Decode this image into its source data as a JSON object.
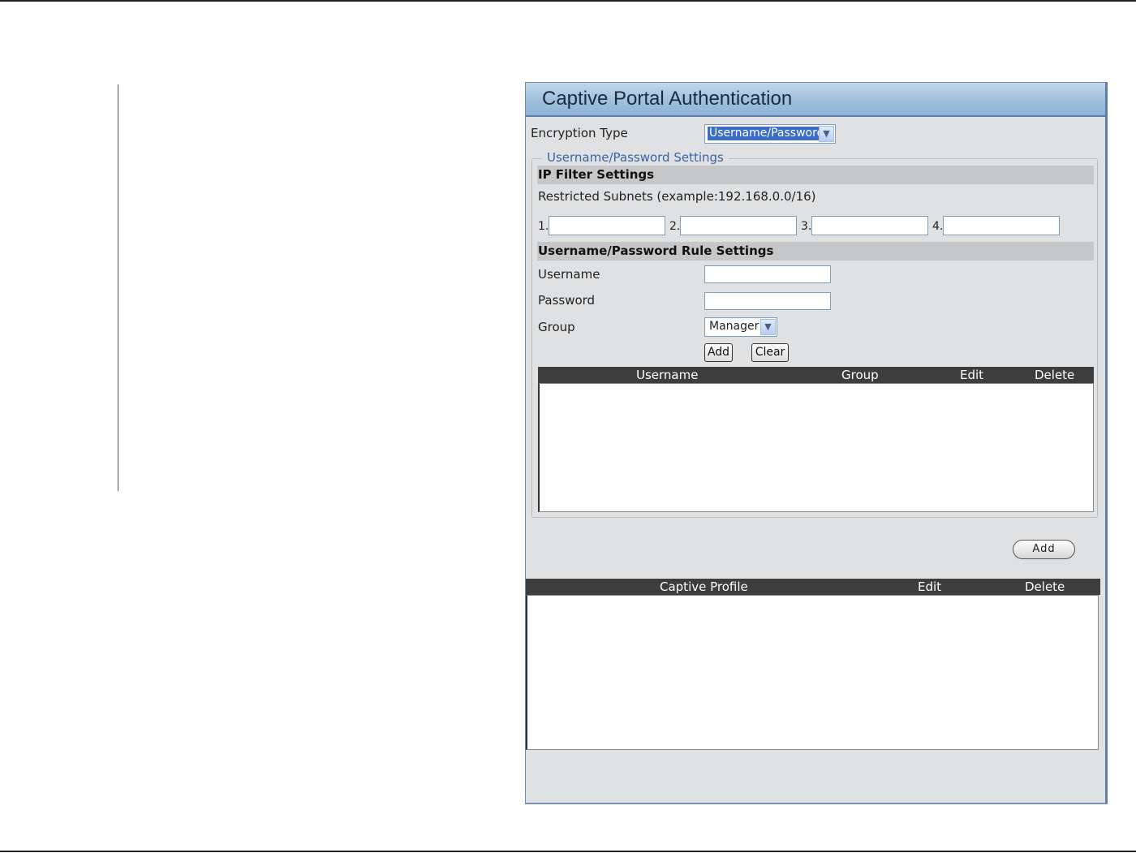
{
  "panel": {
    "title": "Captive Portal Authentication",
    "encryption_type": {
      "label": "Encryption Type",
      "selected": "Username/Password"
    },
    "settings_group": {
      "legend": "Username/Password Settings",
      "ip_filter": {
        "heading": "IP Filter Settings",
        "hint": "Restricted Subnets (example:192.168.0.0/16)",
        "subnets": [
          {
            "label": "1.",
            "value": ""
          },
          {
            "label": "2.",
            "value": ""
          },
          {
            "label": "3.",
            "value": ""
          },
          {
            "label": "4.",
            "value": ""
          }
        ]
      },
      "rule_settings": {
        "heading": "Username/Password Rule Settings",
        "username_label": "Username",
        "username_value": "",
        "password_label": "Password",
        "password_value": "",
        "group_label": "Group",
        "group_selected": "Manager",
        "add_label": "Add",
        "clear_label": "Clear"
      },
      "users_table": {
        "columns": [
          "Username",
          "Group",
          "Edit",
          "Delete"
        ],
        "rows": []
      }
    },
    "add_button_label": "Add",
    "profiles_table": {
      "columns": [
        "Captive Profile",
        "Edit",
        "Delete"
      ],
      "rows": []
    }
  },
  "icons": {
    "dropdown": "chevron-down-icon"
  }
}
